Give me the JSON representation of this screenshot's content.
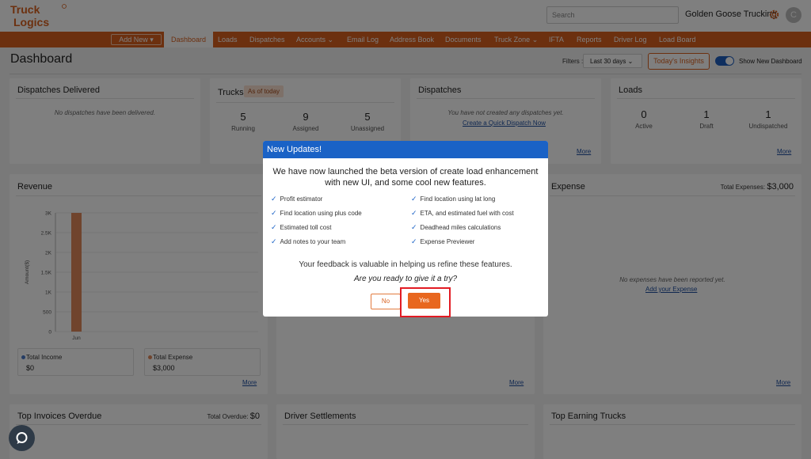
{
  "header": {
    "logo": "Truck Logics",
    "search_placeholder": "Search",
    "company": "Golden Goose Trucking",
    "avatar_initial": "C"
  },
  "nav": {
    "add_new": "Add New",
    "items": [
      "Dashboard",
      "Loads",
      "Dispatches",
      "Accounts",
      "Email Log",
      "Address Book",
      "Documents",
      "Truck Zone",
      "IFTA",
      "Reports",
      "Driver Log",
      "Load Board"
    ],
    "active": "Dashboard"
  },
  "toolbar": {
    "title": "Dashboard",
    "filters_label": "Filters :",
    "filter_value": "Last 30 days",
    "insights": "Today's Insights",
    "toggle_label": "Show New Dashboard"
  },
  "cards": {
    "dispatches_delivered": {
      "title": "Dispatches Delivered",
      "empty": "No dispatches have been delivered."
    },
    "trucks": {
      "title": "Trucks",
      "badge": "As of today",
      "stats": [
        {
          "value": "5",
          "label": "Running"
        },
        {
          "value": "9",
          "label": "Assigned"
        },
        {
          "value": "5",
          "label": "Unassigned"
        }
      ]
    },
    "dispatches": {
      "title": "Dispatches",
      "empty": "You have not created any dispatches yet.",
      "link": "Create a Quick Dispatch Now",
      "more": "More"
    },
    "loads": {
      "title": "Loads",
      "stats": [
        {
          "value": "0",
          "label": "Active"
        },
        {
          "value": "1",
          "label": "Draft"
        },
        {
          "value": "1",
          "label": "Undispatched"
        }
      ],
      "more": "More"
    },
    "revenue": {
      "title": "Revenue",
      "total_income_label": "Total Income",
      "total_income": "$0",
      "total_expense_label": "Total Expense",
      "total_expense": "$3,000",
      "more": "More"
    },
    "middle": {
      "more": "More"
    },
    "expense": {
      "title": "Expense",
      "total_label": "Total Expenses:",
      "total": "$3,000",
      "empty": "No expenses have been reported yet.",
      "link": "Add your Expense",
      "more": "More"
    },
    "invoices": {
      "title": "Top Invoices Overdue",
      "total_label": "Total Overdue:",
      "total": "$0"
    },
    "settlements": {
      "title": "Driver Settlements"
    },
    "earning": {
      "title": "Top Earning Trucks"
    }
  },
  "chart_data": {
    "type": "bar",
    "categories": [
      "Jun"
    ],
    "series": [
      {
        "name": "Total Expense",
        "values": [
          3000
        ]
      }
    ],
    "ylabel": "Amount($)",
    "yticks": [
      "0",
      "500",
      "1K",
      "1.5K",
      "2K",
      "2.5K",
      "3K"
    ],
    "ylim": [
      0,
      3000
    ],
    "bar_color": "#e0885a"
  },
  "modal": {
    "title": "New Updates!",
    "intro": "We have now launched the beta version of create load enhancement with new UI, and some cool new features.",
    "features_left": [
      "Profit estimator",
      "Find location using plus code",
      "Estimated toll cost",
      "Add notes to your team"
    ],
    "features_right": [
      "Find location using lat long",
      "ETA, and estimated fuel with cost",
      "Deadhead miles calculations",
      "Expense Previewer"
    ],
    "feedback": "Your feedback is valuable in helping us refine these features.",
    "ask": "Are you ready to give it a try?",
    "no_label": "No",
    "yes_label": "Yes"
  },
  "colors": {
    "brand": "#d9611f",
    "modal_header": "#1a62c6",
    "highlight": "#e21b23"
  }
}
